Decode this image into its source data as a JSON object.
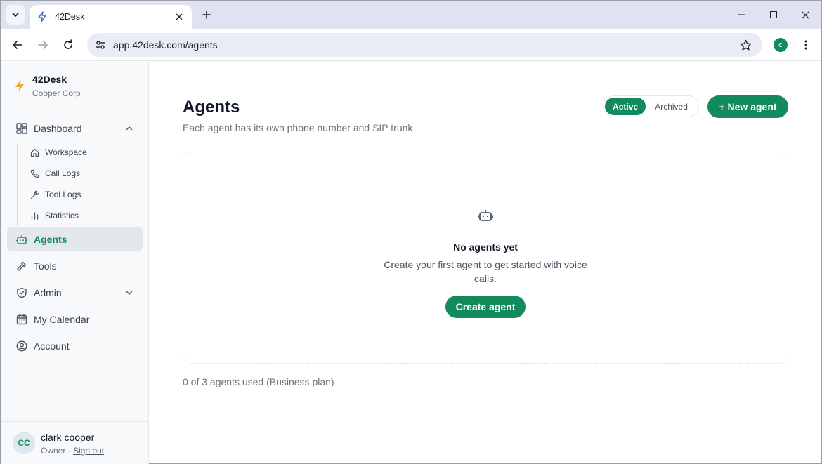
{
  "browser": {
    "tab_title": "42Desk",
    "url": "app.42desk.com/agents",
    "profile_initial": "c"
  },
  "sidebar": {
    "brand_name": "42Desk",
    "org_name": "Cooper Corp",
    "dashboard_label": "Dashboard",
    "sub_items": [
      {
        "label": "Workspace",
        "icon": "home-icon"
      },
      {
        "label": "Call Logs",
        "icon": "phone-icon"
      },
      {
        "label": "Tool Logs",
        "icon": "wrench-icon"
      },
      {
        "label": "Statistics",
        "icon": "bar-chart-icon"
      }
    ],
    "items": [
      {
        "label": "Agents",
        "icon": "robot-icon",
        "active": true
      },
      {
        "label": "Tools",
        "icon": "hammer-icon"
      },
      {
        "label": "Admin",
        "icon": "shield-icon"
      },
      {
        "label": "My Calendar",
        "icon": "calendar-icon"
      },
      {
        "label": "Account",
        "icon": "user-circle-icon"
      }
    ],
    "user": {
      "initials": "CC",
      "name": "clark cooper",
      "role": "Owner",
      "separator": " · ",
      "sign_out": "Sign out"
    }
  },
  "main": {
    "title": "Agents",
    "subtitle": "Each agent has its own phone number and SIP trunk",
    "filter": {
      "active_label": "Active",
      "archived_label": "Archived",
      "selected": "Active"
    },
    "new_agent_label": "+ New agent",
    "empty_state": {
      "title": "No agents yet",
      "description": "Create your first agent to get started with voice calls.",
      "button_label": "Create agent"
    },
    "usage": "0 of 3 agents used (Business plan)"
  },
  "colors": {
    "accent": "#128a5c",
    "bolt": "#f5a524",
    "tabstrip": "#dfe3f1"
  }
}
